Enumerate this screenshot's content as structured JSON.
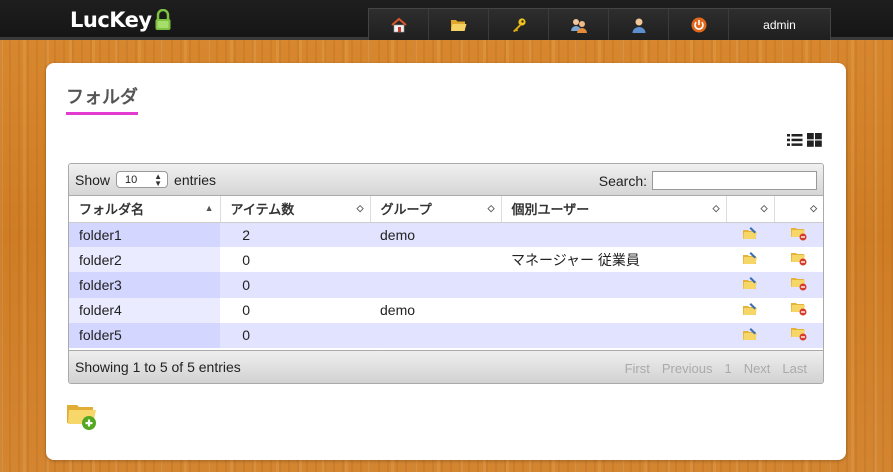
{
  "app": {
    "logo_text": "LucKey"
  },
  "nav": {
    "items": [
      {
        "name": "home-icon",
        "color": "#e05a2b"
      },
      {
        "name": "folder-open-icon",
        "color": "#f0c040"
      },
      {
        "name": "key-icon",
        "color": "#f0c020"
      },
      {
        "name": "users-icon",
        "color": "#f0a040"
      },
      {
        "name": "user-icon",
        "color": "#e08030"
      },
      {
        "name": "power-icon",
        "color": "#e06a1a"
      }
    ],
    "user_label": "admin"
  },
  "page": {
    "title": "フォルダ",
    "title_underline_color": "#e23bd0"
  },
  "table": {
    "length": {
      "show_label": "Show",
      "value": "10",
      "entries_label": "entries"
    },
    "search_label": "Search:",
    "search_value": "",
    "columns": [
      "フォルダ名",
      "アイテム数",
      "グループ",
      "個別ユーザー",
      "",
      ""
    ],
    "rows": [
      {
        "name": "folder1",
        "count": "2",
        "group": "demo",
        "users": ""
      },
      {
        "name": "folder2",
        "count": "0",
        "group": "",
        "users": "マネージャー 従業員"
      },
      {
        "name": "folder3",
        "count": "0",
        "group": "",
        "users": ""
      },
      {
        "name": "folder4",
        "count": "0",
        "group": "demo",
        "users": ""
      },
      {
        "name": "folder5",
        "count": "0",
        "group": "",
        "users": ""
      }
    ],
    "info": "Showing 1 to 5 of 5 entries",
    "paging": {
      "first": "First",
      "previous": "Previous",
      "page": "1",
      "next": "Next",
      "last": "Last"
    }
  },
  "colors": {
    "accent": "#e23bd0",
    "row_odd": "#e2e4ff",
    "row_sorted": "#d3d6ff"
  }
}
